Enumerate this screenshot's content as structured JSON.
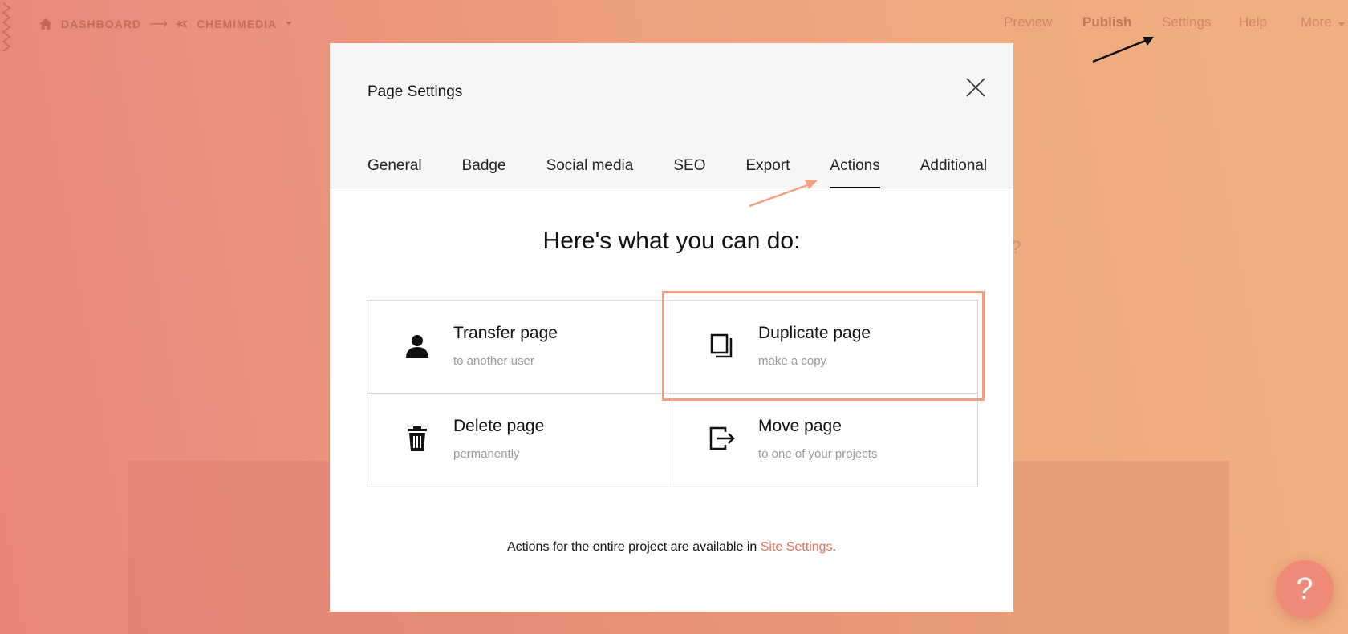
{
  "breadcrumb": {
    "dashboard_label": "DASHBOARD",
    "separator": "⟶",
    "project_label": "CHEMIMEDIA"
  },
  "topnav": {
    "preview": "Preview",
    "publish": "Publish",
    "settings": "Settings",
    "help": "Help",
    "more": "More"
  },
  "background": {
    "partial_text": "e?"
  },
  "modal": {
    "title": "Page Settings",
    "tabs": [
      {
        "label": "General"
      },
      {
        "label": "Badge"
      },
      {
        "label": "Social media"
      },
      {
        "label": "SEO"
      },
      {
        "label": "Export"
      },
      {
        "label": "Actions",
        "active": true
      },
      {
        "label": "Additional"
      }
    ],
    "heading": "Here's what you can do:",
    "actions": [
      {
        "title": "Transfer page",
        "subtitle": "to another user",
        "icon": "user-icon"
      },
      {
        "title": "Duplicate page",
        "subtitle": "make a copy",
        "icon": "copy-icon"
      },
      {
        "title": "Delete page",
        "subtitle": "permanently",
        "icon": "trash-icon"
      },
      {
        "title": "Move page",
        "subtitle": "to one of your projects",
        "icon": "move-out-icon"
      }
    ],
    "footer_text": "Actions for the entire project are available in",
    "footer_link": "Site Settings",
    "footer_period": "."
  },
  "help_button": {
    "label": "?"
  },
  "colors": {
    "accent": "#f26d53",
    "highlight": "#f4a07f",
    "fab": "#f08a78"
  }
}
